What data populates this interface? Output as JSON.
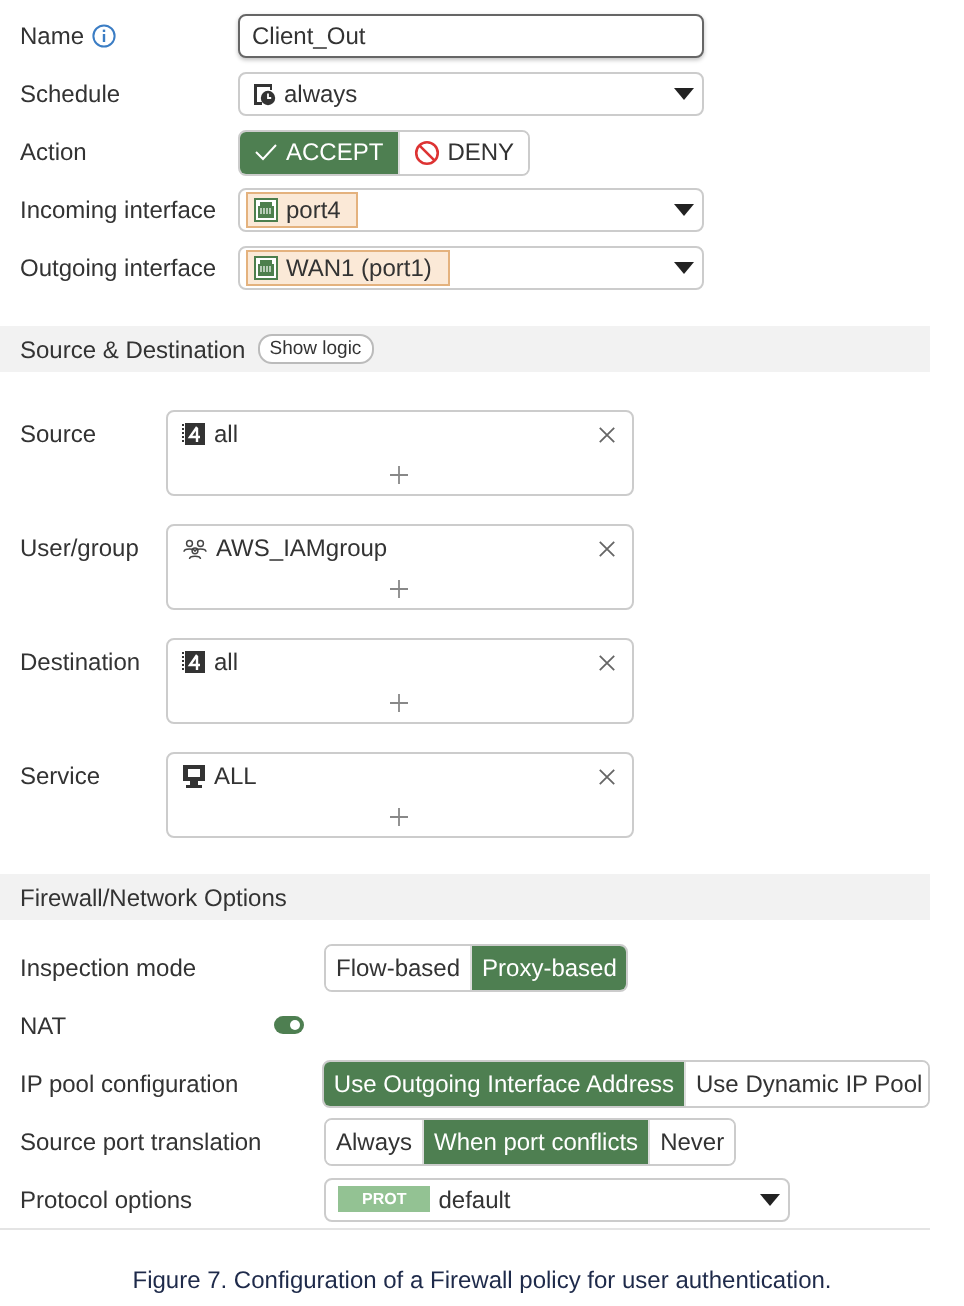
{
  "general": [
    {
      "kind": "text",
      "label": "Name",
      "value": "Client_Out"
    },
    {
      "kind": "schedule",
      "label": "Schedule",
      "value": "always"
    },
    {
      "kind": "action",
      "label": "Action",
      "options": [
        {
          "label": "ACCEPT",
          "selected": true
        },
        {
          "label": "DENY",
          "selected": false
        }
      ]
    },
    {
      "kind": "interface",
      "label": "Incoming interface",
      "value": "port4"
    },
    {
      "kind": "interface",
      "label": "Outgoing interface",
      "value": "WAN1 (port1)"
    }
  ],
  "source_destination": {
    "title": "Source & Destination",
    "button": "Show logic",
    "rows": [
      {
        "label": "Source",
        "entries": [
          {
            "kind": "address",
            "text": "all"
          }
        ]
      },
      {
        "label": "User/group",
        "entries": [
          {
            "kind": "group",
            "text": "AWS_IAMgroup"
          }
        ]
      },
      {
        "label": "Destination",
        "entries": [
          {
            "kind": "address",
            "text": "all"
          }
        ]
      },
      {
        "label": "Service",
        "entries": [
          {
            "kind": "service",
            "text": "ALL"
          }
        ]
      }
    ]
  },
  "firewall_options": {
    "title": "Firewall/Network Options",
    "rows": [
      {
        "kind": "segmented",
        "label": "Inspection mode",
        "options": [
          {
            "label": "Flow-based",
            "selected": false
          },
          {
            "label": "Proxy-based",
            "selected": true
          }
        ]
      },
      {
        "kind": "toggle",
        "label": "NAT",
        "on": true
      },
      {
        "kind": "segmented",
        "label": "IP pool configuration",
        "options": [
          {
            "label": "Use Outgoing Interface Address",
            "selected": true
          },
          {
            "label": "Use Dynamic IP Pool",
            "selected": false
          }
        ]
      },
      {
        "kind": "segmented",
        "label": "Source port translation",
        "options": [
          {
            "label": "Always",
            "selected": false
          },
          {
            "label": "When port conflicts",
            "selected": true
          },
          {
            "label": "Never",
            "selected": false
          }
        ]
      },
      {
        "kind": "select",
        "label": "Protocol options",
        "badge": "PROT",
        "value": "default"
      }
    ]
  },
  "caption": "Figure 7. Configuration of a Firewall policy for user authentication."
}
